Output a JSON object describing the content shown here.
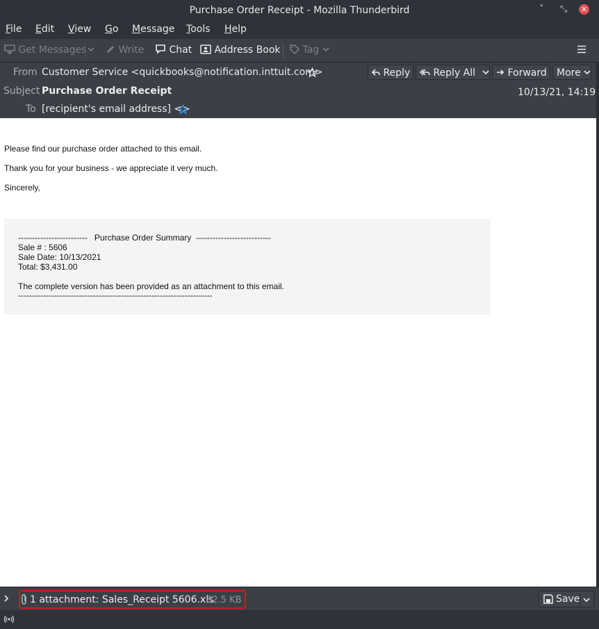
{
  "window": {
    "title": "Purchase Order Receipt - Mozilla Thunderbird",
    "minimize_glyph": "˅",
    "restore_glyph": "⤡",
    "close_glyph": "✕"
  },
  "menubar": [
    {
      "label": "File",
      "key": "F",
      "rest": "ile"
    },
    {
      "label": "Edit",
      "key": "E",
      "rest": "dit"
    },
    {
      "label": "View",
      "key": "V",
      "rest": "iew"
    },
    {
      "label": "Go",
      "key": "G",
      "rest": "o"
    },
    {
      "label": "Message",
      "key": "M",
      "rest": "essage"
    },
    {
      "label": "Tools",
      "key": "T",
      "rest": "ools"
    },
    {
      "label": "Help",
      "key": "H",
      "rest": "elp"
    }
  ],
  "toolbar": {
    "get_messages": "Get Messages",
    "write": "Write",
    "chat": "Chat",
    "address_book": "Address Book",
    "tag": "Tag"
  },
  "header": {
    "from_label": "From",
    "from_value": "Customer Service <quickbooks@notification.inttuit.com>",
    "subject_label": "Subject",
    "subject_value": "Purchase Order Receipt",
    "to_label": "To",
    "to_value": "[recipient's email address] <>",
    "date": "10/13/21, 14:19",
    "reply": "Reply",
    "reply_all": "Reply All",
    "forward": "Forward",
    "more": "More"
  },
  "message": {
    "line1": "Please find our purchase order attached to this email.",
    "line2": "Thank you for your business - we appreciate it very much.",
    "line3": "Sincerely,",
    "summary": {
      "heading": "-------------------------   Purchase Order Summary  ---------------------------",
      "sale_no": "Sale # : 5606",
      "sale_date": "Sale Date: 10/13/2021",
      "total": "Total: $3,431.00",
      "note": "The complete version has been provided as an attachment to this email.",
      "rule": "----------------------------------------------------------------------"
    }
  },
  "attachment": {
    "summary": "1 attachment: Sales_Receipt 5606.xls",
    "size": "82.5 KB",
    "save": "Save"
  },
  "colors": {
    "accent_star": "#3a8ee6",
    "highlight_box": "#d11b1b"
  }
}
